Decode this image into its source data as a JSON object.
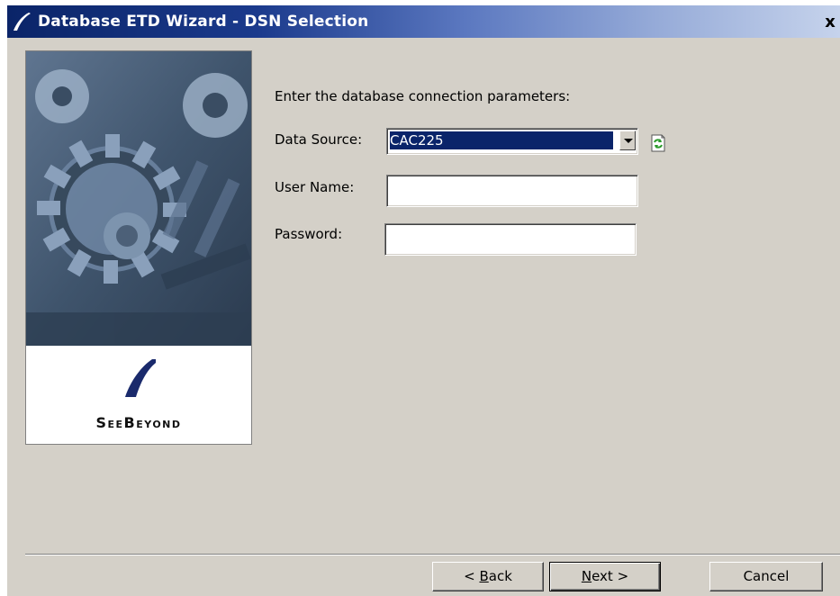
{
  "window": {
    "title": "Database ETD Wizard - DSN Selection",
    "close_label": "X"
  },
  "side_panel": {
    "brand_name": "SeeBeyond",
    "icons": [
      "gears-image",
      "seebeyond-logo"
    ]
  },
  "form": {
    "prompt": "Enter the database connection parameters:",
    "data_source": {
      "label": "Data Source:",
      "value": "CAC225",
      "refresh_icon": "refresh-icon"
    },
    "user_name": {
      "label": "User Name:",
      "value": ""
    },
    "password": {
      "label": "Password:",
      "value": ""
    }
  },
  "buttons": {
    "back": {
      "prefix": "< ",
      "mnemonic": "B",
      "rest": "ack"
    },
    "next": {
      "mnemonic": "N",
      "rest": "ext >"
    },
    "cancel": "Cancel"
  },
  "colors": {
    "dialog_bg": "#d4d0c8",
    "title_gradient_start": "#0a2468",
    "selection": "#0a246a"
  }
}
